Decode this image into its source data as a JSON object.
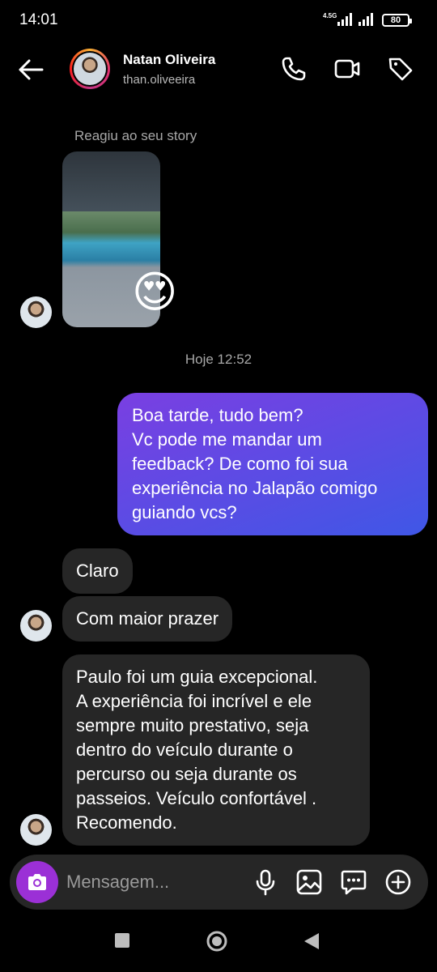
{
  "status": {
    "time": "14:01",
    "network": "4.5G",
    "battery": "80"
  },
  "header": {
    "name": "Natan Oliveira",
    "handle": "than.oliveeira"
  },
  "chat": {
    "story_label": "Reagiu ao seu story",
    "story_reaction": "😍",
    "timestamp": "Hoje 12:52",
    "outgoing": "Boa tarde, tudo bem?\nVc pode me mandar um\nfeedback? De como foi sua\nexperiência no Jalapão comigo\nguiando vcs?",
    "incoming": [
      "Claro",
      "Com maior prazer",
      "Paulo foi um guia excepcional.\nA experiência foi incrível e ele\nsempre muito prestativo, seja\ndentro do veículo durante o\npercurso ou seja durante os\npasseios. Veículo confortável .\nRecomendo."
    ]
  },
  "composer": {
    "placeholder": "Mensagem..."
  },
  "colors": {
    "accent_gradient_start": "#7a3fe2",
    "accent_gradient_end": "#3f57e6",
    "camera": "#9b30d6",
    "bubble_in": "#262626"
  }
}
